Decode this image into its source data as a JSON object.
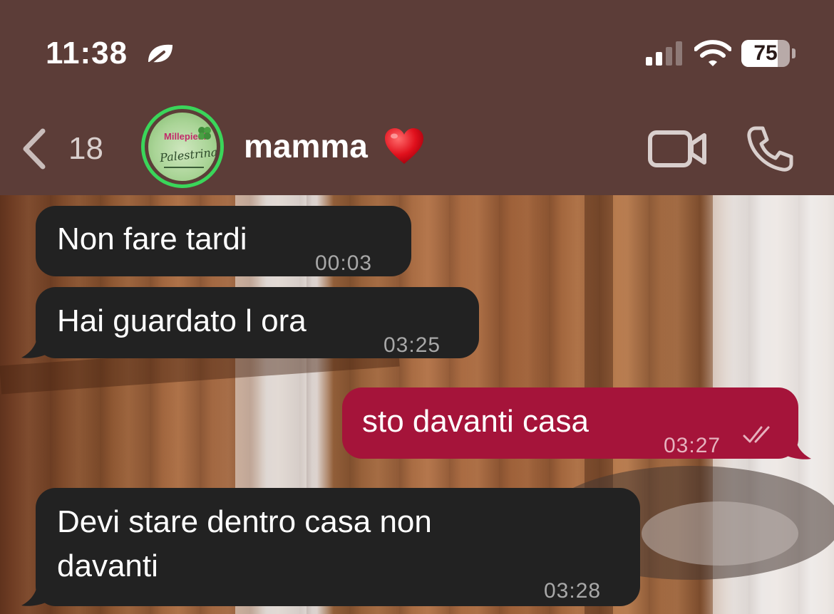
{
  "status_bar": {
    "time": "11:38",
    "battery": "75",
    "battery_level": 0.75,
    "icons": [
      "leaf-icon",
      "signal-icon",
      "wifi-icon",
      "battery-icon"
    ]
  },
  "nav": {
    "back_count": "18",
    "contact_name": "mamma",
    "contact_emoji": "heart-icon",
    "avatar_brand": "Millepiedi",
    "avatar_script": "Palestrina",
    "icons": [
      "back-chevron-icon",
      "video-call-icon",
      "phone-call-icon"
    ]
  },
  "messages": [
    {
      "direction": "incoming",
      "text": "Non fare tardi",
      "time": "00:03"
    },
    {
      "direction": "incoming",
      "text": "Hai guardato l ora",
      "time": "03:25"
    },
    {
      "direction": "outgoing",
      "text": "sto davanti casa",
      "time": "03:27",
      "status": "read"
    },
    {
      "direction": "incoming",
      "text": "Devi stare dentro casa non\ndavanti",
      "time": "03:28"
    }
  ],
  "colors": {
    "header_bg": "#5c3d38",
    "incoming_bubble": "#222222",
    "outgoing_bubble": "#a5143a",
    "avatar_ring": "#3ad65a"
  }
}
